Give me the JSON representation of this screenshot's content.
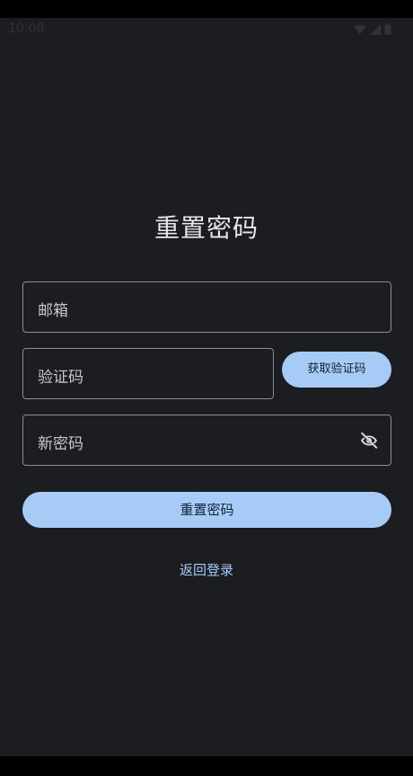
{
  "status_bar": {
    "time": "10:08",
    "icons": [
      "wifi-icon",
      "signal-icon",
      "battery-icon"
    ]
  },
  "page": {
    "title": "重置密码"
  },
  "form": {
    "email_label": "邮箱",
    "code_label": "验证码",
    "get_code_button": "获取验证码",
    "password_label": "新密码",
    "password_toggle_icon": "eye-off-icon"
  },
  "actions": {
    "reset_button": "重置密码",
    "back_to_login": "返回登录"
  },
  "colors": {
    "background": "#1b1d21",
    "accent": "#a6cbf7",
    "outline": "#8a8f97",
    "title_text": "#e6e8ec",
    "label_text": "#c4c7cc",
    "button_text": "#0f2236"
  }
}
